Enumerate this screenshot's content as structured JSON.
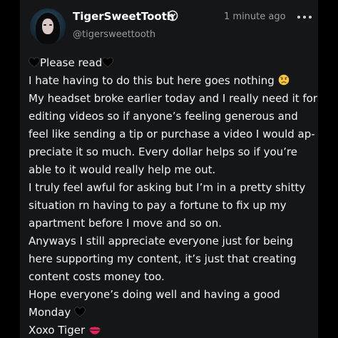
{
  "post": {
    "author": {
      "display_name": "TigerSweetTooth",
      "handle": "@tigersweettooth",
      "verified_icon": "verified-check-icon"
    },
    "timestamp": "1 minute ago",
    "menu_icon": "more-horizontal-icon",
    "lines": [
      "Please read",
      "I hate having to do this but here goes nothing",
      "My headset broke earlier today and I really need it for",
      "editing videos so if anyone’s feeling generous and",
      "feel like sending a tip or purchase a video I would ap-",
      "preciate it so much. Every dollar helps so if you’re",
      "able to it would really help me out.",
      "I truly feel awful for asking but I’m in a pretty shitty",
      "situation rn having to pay a fortune to fix up my",
      "apartment before I move and so on.",
      "Anyways I still appreciate everyone just for being",
      "here supporting my content, it’s just that creating",
      "content costs money too.",
      "Hope everyone’s doing well and having a good",
      "Monday",
      "Xoxo Tiger"
    ],
    "emojis": {
      "black_heart": "🖤",
      "worried_face": "😟",
      "kiss_mark": "💋"
    },
    "colors": {
      "background": "#151617",
      "text": "#f4f4f4",
      "muted": "#9a9b9c"
    }
  }
}
